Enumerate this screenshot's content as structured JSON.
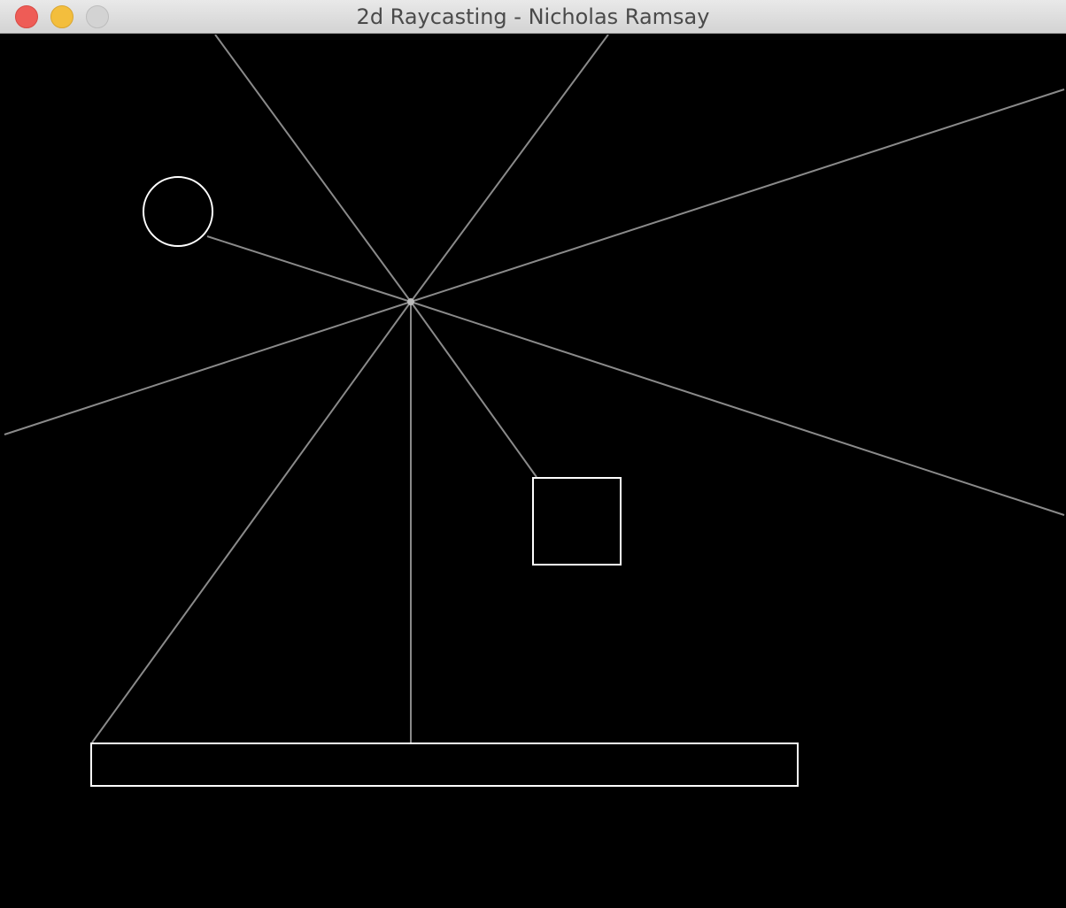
{
  "window": {
    "title": "2d Raycasting - Nicholas Ramsay"
  },
  "colors": {
    "background": "#000000",
    "wall": "#ffffff",
    "ray": "#8a8a8a",
    "titlebar_text": "#4a4a4a",
    "close": "#ee5c56",
    "minimize": "#f3be3d",
    "zoom": "#d3d3d3"
  },
  "icons": {
    "close": "close-button-icon",
    "minimize": "minimize-button-icon",
    "zoom": "zoom-button-icon"
  }
}
